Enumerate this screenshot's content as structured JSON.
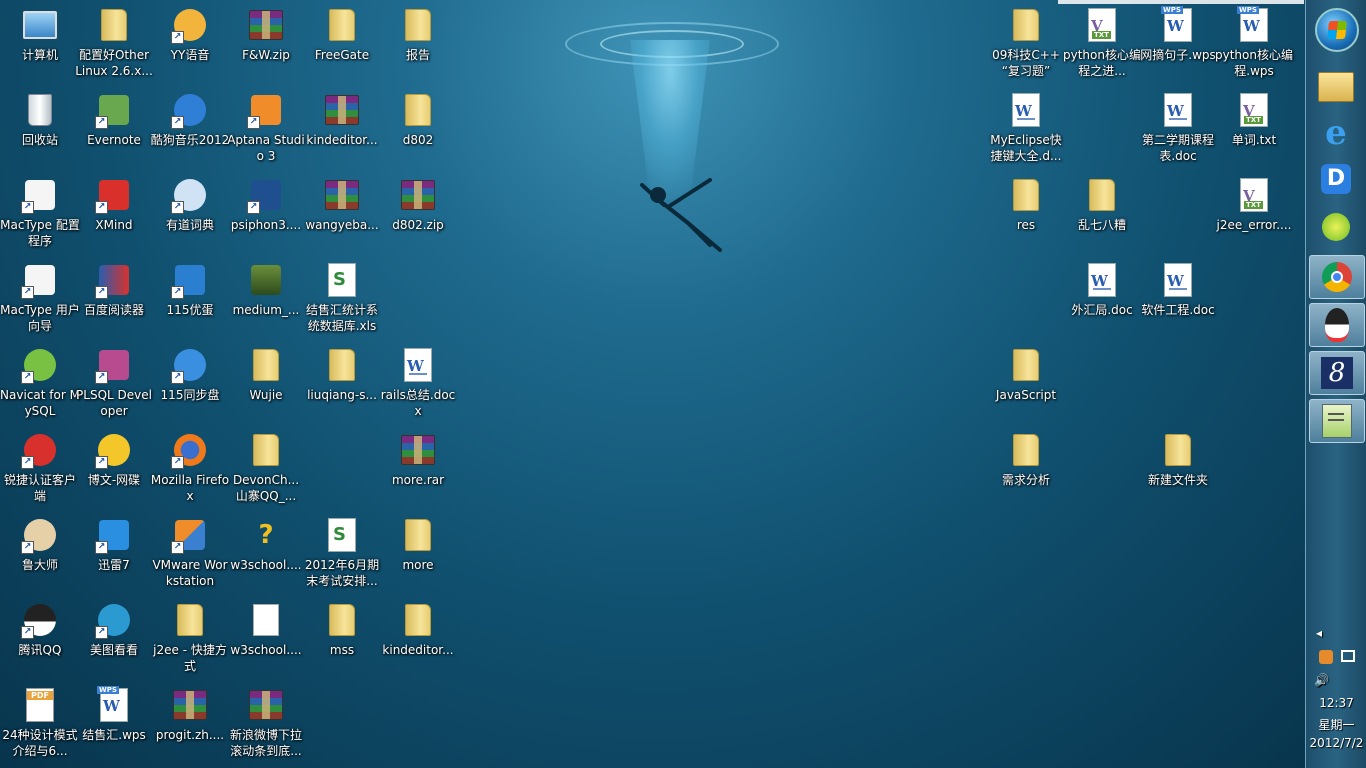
{
  "desktop_icons": [
    {
      "label": "计算机",
      "icon": "computer-icon"
    },
    {
      "label": "配置好Other Linux 2.6.x...",
      "icon": "folder-icon"
    },
    {
      "label": "YY语音",
      "icon": "yy-icon"
    },
    {
      "label": "F&W.zip",
      "icon": "rar-icon"
    },
    {
      "label": "FreeGate",
      "icon": "folder-icon"
    },
    {
      "label": "报告",
      "icon": "folder-icon"
    },
    {
      "label": "回收站",
      "icon": "recycle-bin-icon"
    },
    {
      "label": "Evernote",
      "icon": "evernote-icon"
    },
    {
      "label": "酷狗音乐2012",
      "icon": "kugou-icon"
    },
    {
      "label": "Aptana Studio 3",
      "icon": "aptana-icon"
    },
    {
      "label": "kindeditor...",
      "icon": "rar-icon"
    },
    {
      "label": "d802",
      "icon": "folder-icon"
    },
    {
      "label": "MacType 配置程序",
      "icon": "mactype-icon"
    },
    {
      "label": "XMind",
      "icon": "xmind-icon"
    },
    {
      "label": "有道词典",
      "icon": "youdao-icon"
    },
    {
      "label": "psiphon3....",
      "icon": "psiphon-icon"
    },
    {
      "label": "wangyeba...",
      "icon": "rar-icon"
    },
    {
      "label": "d802.zip",
      "icon": "rar-icon"
    },
    {
      "label": "MacType 用户向导",
      "icon": "mactype-icon"
    },
    {
      "label": "百度阅读器",
      "icon": "baidu-reader-icon"
    },
    {
      "label": "115优蛋",
      "icon": "115-icon"
    },
    {
      "label": "medium_...",
      "icon": "image-icon"
    },
    {
      "label": "结售汇统计系统数据库.xls",
      "icon": "xls-icon"
    },
    {
      "label": "Navicat for MySQL",
      "icon": "navicat-icon"
    },
    {
      "label": "PLSQL Developer",
      "icon": "plsql-icon"
    },
    {
      "label": "115同步盘",
      "icon": "115-sync-icon"
    },
    {
      "label": "Wujie",
      "icon": "folder-icon"
    },
    {
      "label": "liuqiang-s...",
      "icon": "folder-icon"
    },
    {
      "label": "rails总结.docx",
      "icon": "word-icon"
    },
    {
      "label": "锐捷认证客户端",
      "icon": "ruijie-icon"
    },
    {
      "label": "博文-网碟",
      "icon": "bowen-icon"
    },
    {
      "label": "Mozilla Firefox",
      "icon": "firefox-icon"
    },
    {
      "label": "DevonCh... 山寨QQ_...",
      "icon": "folder-icon"
    },
    {
      "label": "more.rar",
      "icon": "rar-icon"
    },
    {
      "label": "鲁大师",
      "icon": "ludashi-icon"
    },
    {
      "label": "迅雷7",
      "icon": "xunlei-icon"
    },
    {
      "label": "VMware Workstation",
      "icon": "vmware-icon"
    },
    {
      "label": "w3school....",
      "icon": "help-icon"
    },
    {
      "label": "2012年6月期末考试安排...",
      "icon": "xls-icon"
    },
    {
      "label": "more",
      "icon": "folder-icon"
    },
    {
      "label": "腾讯QQ",
      "icon": "qq-icon"
    },
    {
      "label": "美图看看",
      "icon": "meitu-icon"
    },
    {
      "label": "j2ee - 快捷方式",
      "icon": "folder-icon"
    },
    {
      "label": "w3school....",
      "icon": "blank-file-icon"
    },
    {
      "label": "mss",
      "icon": "folder-icon"
    },
    {
      "label": "kindeditor...",
      "icon": "folder-icon"
    },
    {
      "label": "24种设计模式介绍与6...",
      "icon": "pdf-icon"
    },
    {
      "label": "结售汇.wps",
      "icon": "wps-icon"
    },
    {
      "label": "progit.zh....",
      "icon": "rar-icon"
    },
    {
      "label": "新浪微博下拉滚动条到底...",
      "icon": "rar-icon"
    },
    {
      "label": "09科技C++ “复习题”",
      "icon": "folder-icon"
    },
    {
      "label": "python核心编程之进...",
      "icon": "txt-icon"
    },
    {
      "label": "网摘句子.wps",
      "icon": "wps-icon"
    },
    {
      "label": "python核心编程.wps",
      "icon": "wps-icon"
    },
    {
      "label": "MyEclipse快捷键大全.d...",
      "icon": "word-icon"
    },
    {
      "label": "第二学期课程表.doc",
      "icon": "word-icon"
    },
    {
      "label": "单词.txt",
      "icon": "txt-icon"
    },
    {
      "label": "res",
      "icon": "folder-icon"
    },
    {
      "label": "乱七八糟",
      "icon": "folder-icon"
    },
    {
      "label": "j2ee_error....",
      "icon": "txt-icon"
    },
    {
      "label": "外汇局.doc",
      "icon": "word-icon"
    },
    {
      "label": "软件工程.doc",
      "icon": "word-icon"
    },
    {
      "label": "JavaScript",
      "icon": "folder-icon"
    },
    {
      "label": "需求分析",
      "icon": "folder-icon"
    },
    {
      "label": "新建文件夹",
      "icon": "folder-icon"
    }
  ],
  "taskbar": {
    "start_button": "start-orb-icon",
    "items": [
      {
        "name": "explorer",
        "icon": "explorer-folder-icon"
      },
      {
        "name": "internet-explorer",
        "icon": "ie-icon"
      },
      {
        "name": "d-app",
        "icon": "d-app-icon"
      },
      {
        "name": "kugou",
        "icon": "kugou-icon"
      },
      {
        "name": "chrome",
        "icon": "chrome-icon"
      },
      {
        "name": "qq",
        "icon": "qq-icon"
      },
      {
        "name": "app-8",
        "icon": "eight-icon"
      },
      {
        "name": "notepad-plus",
        "icon": "notepad-icon"
      }
    ],
    "tray": {
      "expand": "◂",
      "time": "12:37",
      "weekday": "星期一",
      "date": "2012/7/2"
    }
  }
}
